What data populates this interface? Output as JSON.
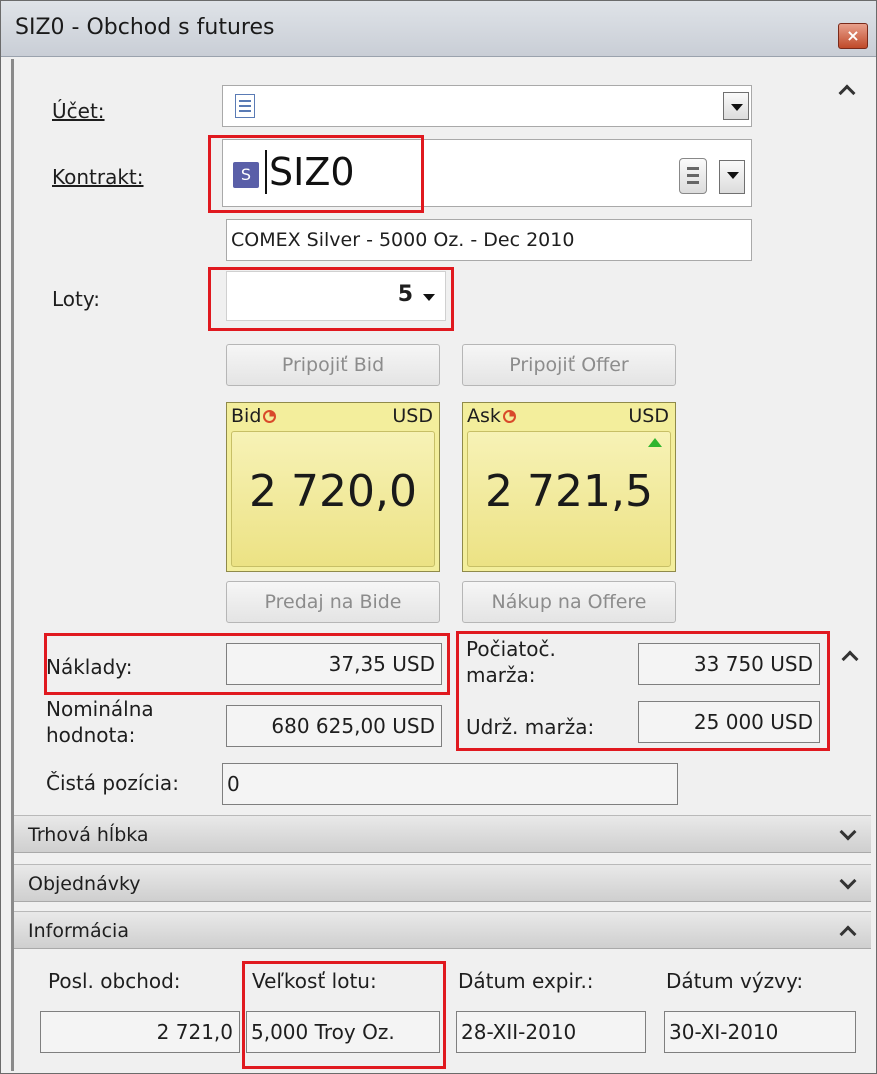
{
  "window": {
    "title": "SIZ0 - Obchod s futures",
    "close_glyph": "×"
  },
  "form": {
    "account_label": "Účet:",
    "contract_label": "Kontrakt:",
    "contract_badge": "S",
    "contract_value": "SIZ0",
    "contract_description": "COMEX Silver - 5000 Oz. - Dec 2010",
    "lots_label": "Loty:",
    "lots_value": "5"
  },
  "buttons": {
    "join_bid": "Pripojiť Bid",
    "join_offer": "Pripojiť Offer",
    "sell_bid": "Predaj na Bide",
    "buy_offer": "Nákup na Offere"
  },
  "quotes": {
    "bid": {
      "label": "Bid",
      "currency": "USD",
      "price": "2 720,0"
    },
    "ask": {
      "label": "Ask",
      "currency": "USD",
      "price": "2 721,5"
    }
  },
  "costs": {
    "costs_label": "Náklady:",
    "costs_value": "37,35 USD",
    "nominal_label_1": "Nominálna",
    "nominal_label_2": "hodnota:",
    "nominal_value": "680 625,00 USD",
    "net_position_label": "Čistá pozícia:",
    "net_position_value": "0",
    "initial_margin_label_1": "Počiatoč.",
    "initial_margin_label_2": "marža:",
    "initial_margin_value": "33 750 USD",
    "maintenance_margin_label": "Udrž. marža:",
    "maintenance_margin_value": "25 000 USD"
  },
  "sections": {
    "market_depth": "Trhová hĺbka",
    "orders": "Objednávky",
    "info": "Informácia"
  },
  "info": {
    "last_trade_label": "Posl. obchod:",
    "last_trade_value": "2 721,0",
    "lot_size_label": "Veľkosť lotu:",
    "lot_size_value": "5,000 Troy Oz.",
    "expiry_label": "Dátum expir.:",
    "expiry_value": "28-XII-2010",
    "call_date_label": "Dátum výzvy:",
    "call_date_value": "30-XI-2010"
  },
  "colors": {
    "highlight": "#e0191f",
    "quote_bg": "#f3ee9c",
    "uptick": "#2fb52f"
  }
}
